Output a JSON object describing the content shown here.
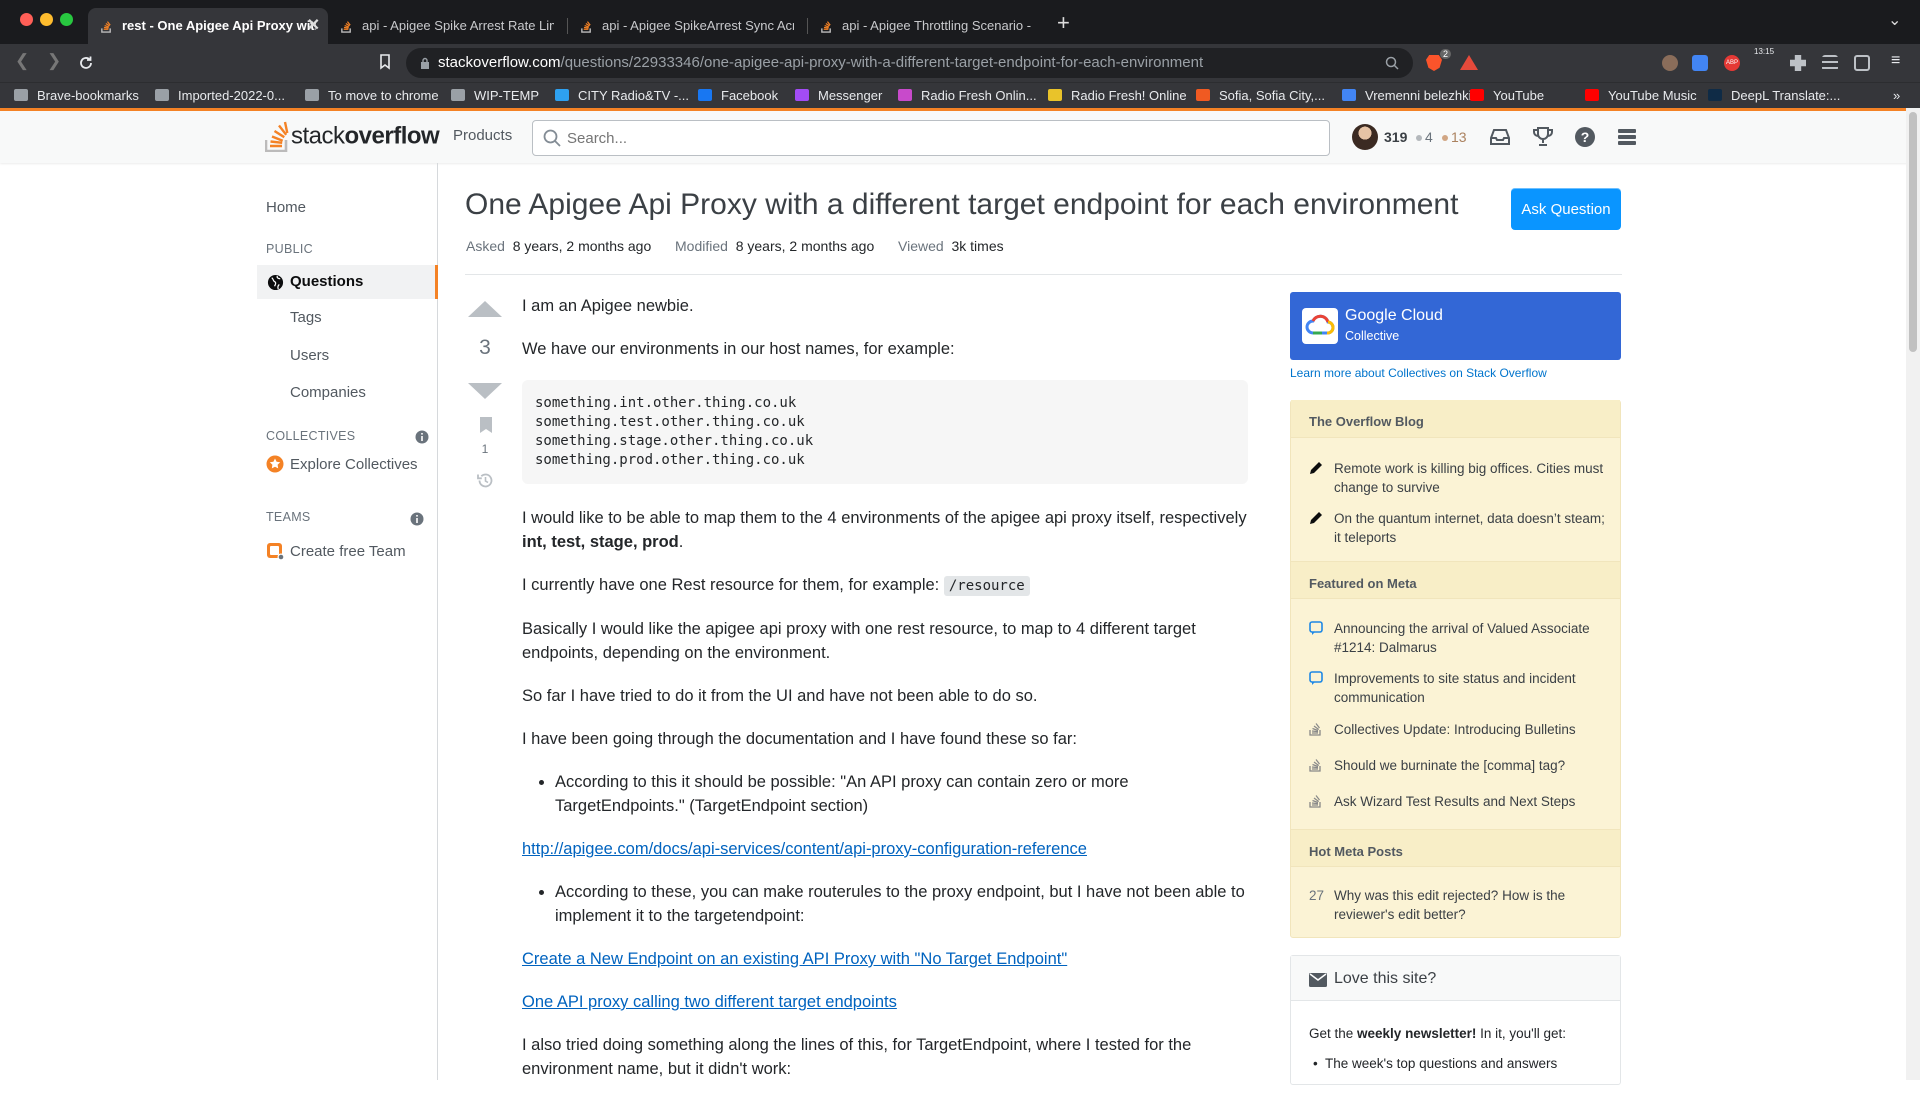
{
  "browser": {
    "tabs": [
      {
        "title": "rest - One Apigee Api Proxy with a different target endpoint for each environment",
        "active": true
      },
      {
        "title": "api - Apigee Spike Arrest Rate Limit",
        "active": false
      },
      {
        "title": "api - Apigee SpikeArrest Sync Across",
        "active": false
      },
      {
        "title": "api - Apigee Throttling Scenario - St",
        "active": false
      }
    ],
    "close_tab": "✕",
    "new_tab": "+",
    "address": {
      "domain": "stackoverflow.com",
      "path": "/questions/22933346/one-apigee-api-proxy-with-a-different-target-endpoint-for-each-environment"
    },
    "toolbar_time": "13:15",
    "brave_badge": "2",
    "bookmarks": [
      {
        "label": "Brave-bookmarks",
        "color": "#9aa0a6"
      },
      {
        "label": "Imported-2022-0...",
        "color": "#9aa0a6"
      },
      {
        "label": "To move to chrome",
        "color": "#9aa0a6"
      },
      {
        "label": "WIP-TEMP",
        "color": "#9aa0a6"
      },
      {
        "label": "CITY Radio&TV -...",
        "color": "#2ea1f0"
      },
      {
        "label": "Facebook",
        "color": "#1877f2"
      },
      {
        "label": "Messenger",
        "color": "#a24cf5"
      },
      {
        "label": "Radio Fresh Onlin...",
        "color": "#c84acb"
      },
      {
        "label": "Radio Fresh! Online",
        "color": "#e9c32a"
      },
      {
        "label": "Sofia, Sofia City,...",
        "color": "#f05a22"
      },
      {
        "label": "Vremenni belezhki...",
        "color": "#4285f4"
      },
      {
        "label": "YouTube",
        "color": "#ff0000"
      },
      {
        "label": "YouTube Music",
        "color": "#ff0000"
      },
      {
        "label": "DeepL Translate:...",
        "color": "#0f2b46"
      }
    ],
    "more_bookmarks": "»"
  },
  "header": {
    "logo_light": "stack",
    "logo_bold": "overflow",
    "products": "Products",
    "search_placeholder": "Search...",
    "reputation": "319",
    "silver_badges": "4",
    "bronze_badges": "13"
  },
  "leftnav": {
    "home": "Home",
    "public_heading": "PUBLIC",
    "questions": "Questions",
    "tags": "Tags",
    "users": "Users",
    "companies": "Companies",
    "collectives_heading": "COLLECTIVES",
    "explore_collectives": "Explore Collectives",
    "teams_heading": "TEAMS",
    "create_team": "Create free Team"
  },
  "question": {
    "title": "One Apigee Api Proxy with a different target endpoint for each environment",
    "ask_button": "Ask Question",
    "asked_label": "Asked",
    "asked_value": "8 years, 2 months ago",
    "modified_label": "Modified",
    "modified_value": "8 years, 2 months ago",
    "viewed_label": "Viewed",
    "viewed_value": "3k times",
    "score": "3",
    "bookmark_count": "1",
    "body": {
      "p1": "I am an Apigee newbie.",
      "p2": "We have our environments in our host names, for example:",
      "code": "something.int.other.thing.co.uk\nsomething.test.other.thing.co.uk\nsomething.stage.other.thing.co.uk\nsomething.prod.other.thing.co.uk",
      "p3_text": "I would like to be able to map them to the 4 environments of the apigee api proxy itself, respectively ",
      "p3_bold": "int, test, stage, prod",
      "p3_end": ".",
      "p4_text": "I currently have one Rest resource for them, for example: ",
      "p4_code": "/resource",
      "p5": "Basically I would like the apigee api proxy with one rest resource, to map to 4 different target endpoints, depending on the environment.",
      "p6": "So far I have tried to do it from the UI and have not been able to do so.",
      "p7": "I have been going through the documentation and I have found these so far:",
      "li1": "According to this it should be possible: \"An API proxy can contain zero or more TargetEndpoints.\" (TargetEndpoint section)",
      "link1": "http://apigee.com/docs/api-services/content/api-proxy-configuration-reference",
      "li2": "According to these, you can make routerules to the proxy endpoint, but I have not been able to implement it to the targetendpoint:",
      "link2": "Create a New Endpoint on an existing API Proxy with \"No Target Endpoint\"",
      "link3": "One API proxy calling two different target endpoints",
      "p8": "I also tried doing something along the lines of this, for TargetEndpoint, where I tested for the environment name, but it didn't work:"
    }
  },
  "sidebar": {
    "collective_name": "Google Cloud",
    "collective_sub": "Collective",
    "collective_link": "Learn more about Collectives on Stack Overflow",
    "blog_heading": "The Overflow Blog",
    "blog_items": [
      "Remote work is killing big offices. Cities must change to survive",
      "On the quantum internet, data doesn’t steam; it teleports"
    ],
    "meta_heading": "Featured on Meta",
    "meta_items": [
      "Announcing the arrival of Valued Associate #1214: Dalmarus",
      "Improvements to site status and incident communication",
      "Collectives Update: Introducing Bulletins",
      "Should we burninate the [comma] tag?",
      "Ask Wizard Test Results and Next Steps"
    ],
    "hot_heading": "Hot Meta Posts",
    "hot_count": "27",
    "hot_item": "Why was this edit rejected? How is the reviewer's edit better?",
    "love_title": "Love this site?",
    "newsletter_pre": "Get the ",
    "newsletter_bold": "weekly newsletter!",
    "newsletter_post": " In it, you'll get:",
    "newsletter_item": "The week's top questions and answers"
  }
}
